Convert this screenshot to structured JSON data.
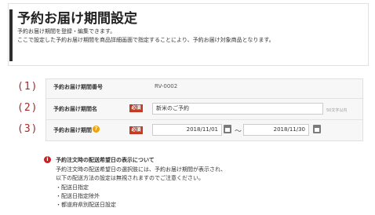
{
  "header": {
    "title": "予約お届け期間設定",
    "description_lines": [
      "予約お届け期間を登録・編集できます。",
      "ここで設定した予約お届け期間を商品詳細画面で指定することにより、予約お届け対象商品となります。"
    ]
  },
  "form": {
    "rows": [
      {
        "num": "(1)",
        "label": "予約お届け期間番号",
        "value": "RV-0002"
      },
      {
        "num": "(2)",
        "label": "予約お届け期間名",
        "required": "必須",
        "value": "新米のご予約",
        "hint": "50文字以内"
      },
      {
        "num": "(3)",
        "label": "予約お届け期間",
        "required": "必須",
        "help_icon": "?",
        "start_date": "2018/11/01",
        "separator": "〜",
        "end_date": "2018/11/30"
      }
    ]
  },
  "notice": {
    "icon": "i",
    "title": "予約注文時の配送希望日の表示について",
    "lines": [
      "予約注文時の配送希望日の選択肢には、予約お届け期間が表示され、",
      "以下の配送方法の設定は無視されますのでご注意ください。",
      "・配送日指定",
      "・配送日指定除外",
      "・都道府県別配送日設定"
    ]
  },
  "colors": {
    "required_badge": "#c23b22",
    "row_number": "#a52a2a",
    "help_icon": "#f0a20b",
    "notice_icon": "#cc1f1f"
  }
}
